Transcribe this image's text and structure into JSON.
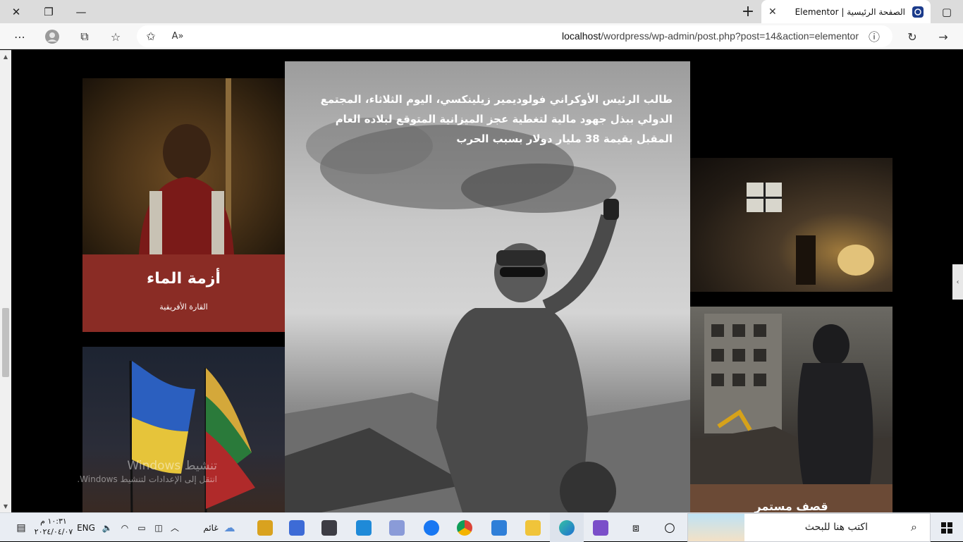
{
  "browser": {
    "tab_title": "الصفحة الرئيسية | Elementor",
    "url_host": "localhost",
    "url_path": "/wordpress/wp-admin/post.php?post=14&action=elementor"
  },
  "page": {
    "main_article_text": "طالب الرئيس الأوكراني فولوديمير زيلينكسي، اليوم الثلاثاء، المجتمع الدولي ببذل جهود مالية لتغطية عجز الميزانية المتوقع لبلاده العام المقبل بقيمة 38 مليار دولار بسبب الحرب",
    "card_water": {
      "title": "أزمة الماء",
      "subtitle": "القارة الأفريقية"
    },
    "card_city": {
      "title": "قصف مستمر"
    },
    "colors": {
      "water_caption": "#8a2c25",
      "city_caption": "#6b4a36"
    }
  },
  "watermark": {
    "line1": "تنشيط Windows",
    "line2": "انتقل إلى الإعدادات لتنشيط Windows."
  },
  "taskbar": {
    "search_placeholder": "اكتب هنا للبحث",
    "weather": "غائم",
    "language": "ENG",
    "time": "١٠:٣١ م",
    "date": "٢٠٢٤/٠٤/٠٧"
  }
}
